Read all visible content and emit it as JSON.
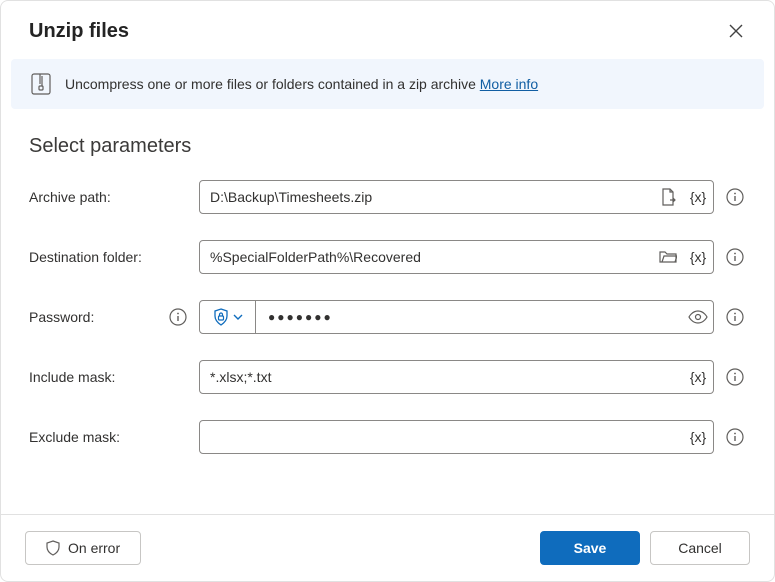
{
  "header": {
    "title": "Unzip files"
  },
  "banner": {
    "text": "Uncompress one or more files or folders contained in a zip archive ",
    "link": "More info"
  },
  "section": {
    "title": "Select parameters"
  },
  "fields": {
    "archive": {
      "label": "Archive path:",
      "value": "D:\\Backup\\Timesheets.zip"
    },
    "destination": {
      "label": "Destination folder:",
      "value": "%SpecialFolderPath%\\Recovered"
    },
    "password": {
      "label": "Password:",
      "mask": "●●●●●●●"
    },
    "include": {
      "label": "Include mask:",
      "value": "*.xlsx;*.txt"
    },
    "exclude": {
      "label": "Exclude mask:",
      "value": ""
    }
  },
  "var_token": "{x}",
  "footer": {
    "onerror": "On error",
    "save": "Save",
    "cancel": "Cancel"
  }
}
